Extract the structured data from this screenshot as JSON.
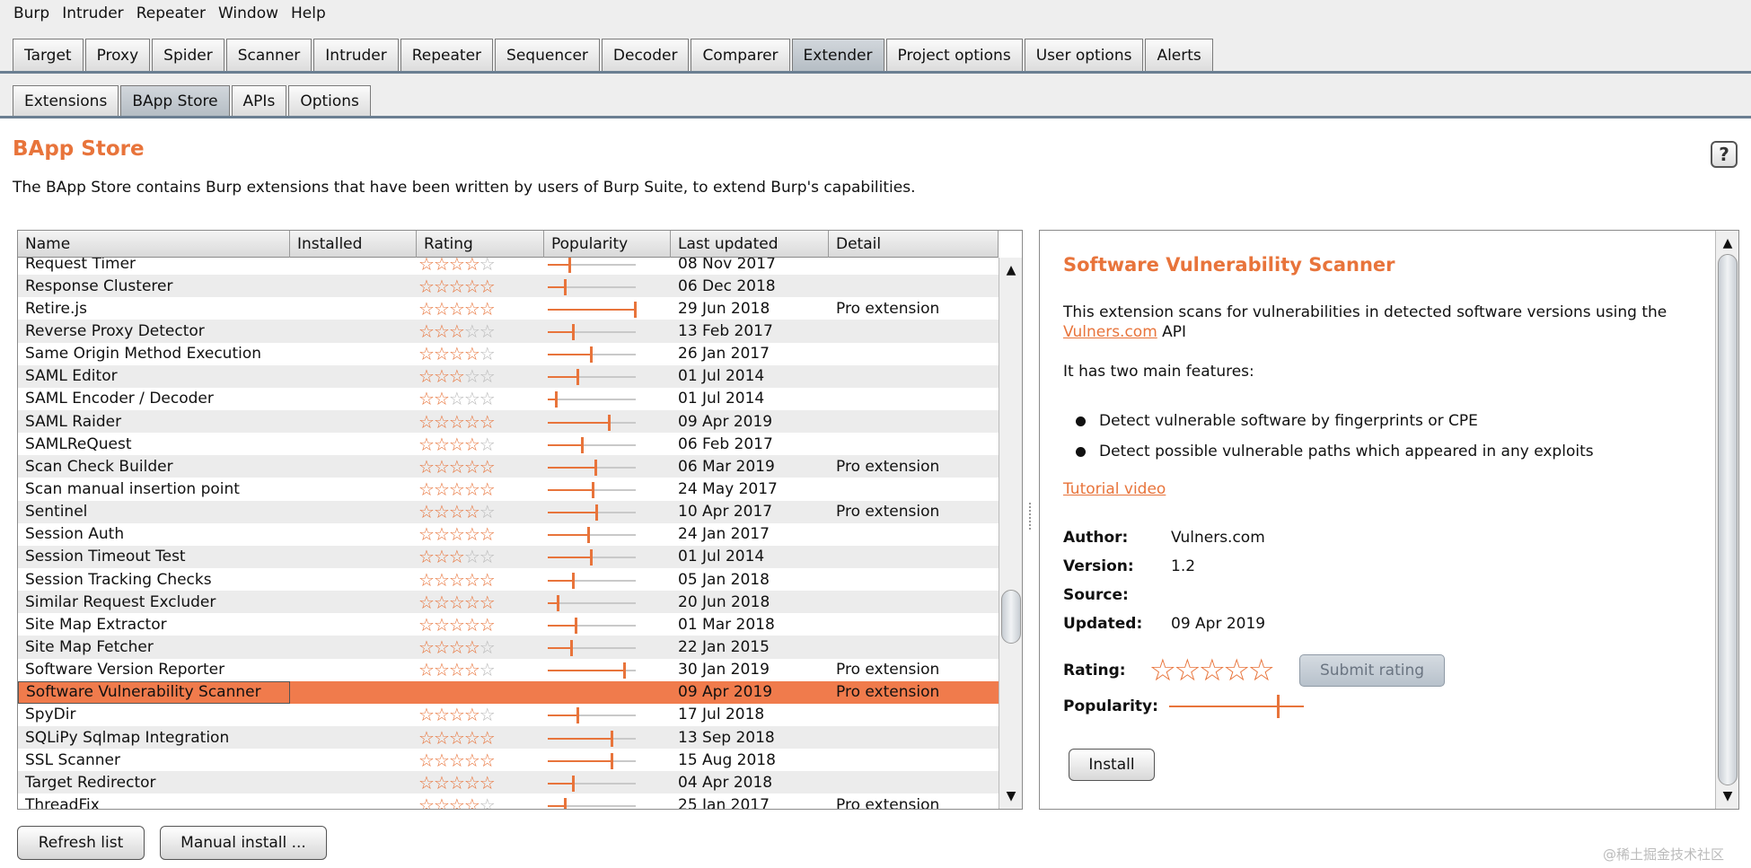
{
  "menu": [
    "Burp",
    "Intruder",
    "Repeater",
    "Window",
    "Help"
  ],
  "main_tabs": [
    "Target",
    "Proxy",
    "Spider",
    "Scanner",
    "Intruder",
    "Repeater",
    "Sequencer",
    "Decoder",
    "Comparer",
    "Extender",
    "Project options",
    "User options",
    "Alerts"
  ],
  "main_tab_active": "Extender",
  "sub_tabs": [
    "Extensions",
    "BApp Store",
    "APIs",
    "Options"
  ],
  "sub_tab_active": "BApp Store",
  "page": {
    "title": "BApp Store",
    "help_label": "?",
    "description": "The BApp Store contains Burp extensions that have been written by users of Burp Suite, to extend Burp's capabilities."
  },
  "table": {
    "columns": [
      "Name",
      "Installed",
      "Rating",
      "Popularity",
      "Last updated",
      "Detail"
    ],
    "rows": [
      {
        "name": "Request Timer",
        "rating": 4,
        "popularity": 0.25,
        "updated": "08 Nov 2017",
        "detail": ""
      },
      {
        "name": "Response Clusterer",
        "rating": 5,
        "popularity": 0.2,
        "updated": "06 Dec 2018",
        "detail": ""
      },
      {
        "name": "Retire.js",
        "rating": 5,
        "popularity": 1.0,
        "updated": "29 Jun 2018",
        "detail": "Pro extension"
      },
      {
        "name": "Reverse Proxy Detector",
        "rating": 3,
        "popularity": 0.3,
        "updated": "13 Feb 2017",
        "detail": ""
      },
      {
        "name": "Same Origin Method Execution",
        "rating": 4,
        "popularity": 0.5,
        "updated": "26 Jan 2017",
        "detail": ""
      },
      {
        "name": "SAML Editor",
        "rating": 3,
        "popularity": 0.35,
        "updated": "01 Jul 2014",
        "detail": ""
      },
      {
        "name": "SAML Encoder / Decoder",
        "rating": 2,
        "popularity": 0.1,
        "updated": "01 Jul 2014",
        "detail": ""
      },
      {
        "name": "SAML Raider",
        "rating": 5,
        "popularity": 0.7,
        "updated": "09 Apr 2019",
        "detail": ""
      },
      {
        "name": "SAMLReQuest",
        "rating": 4,
        "popularity": 0.4,
        "updated": "06 Feb 2017",
        "detail": ""
      },
      {
        "name": "Scan Check Builder",
        "rating": 5,
        "popularity": 0.55,
        "updated": "06 Mar 2019",
        "detail": "Pro extension"
      },
      {
        "name": "Scan manual insertion point",
        "rating": 5,
        "popularity": 0.52,
        "updated": "24 May 2017",
        "detail": ""
      },
      {
        "name": "Sentinel",
        "rating": 4,
        "popularity": 0.56,
        "updated": "10 Apr 2017",
        "detail": "Pro extension"
      },
      {
        "name": "Session Auth",
        "rating": 5,
        "popularity": 0.47,
        "updated": "24 Jan 2017",
        "detail": ""
      },
      {
        "name": "Session Timeout Test",
        "rating": 3,
        "popularity": 0.5,
        "updated": "01 Jul 2014",
        "detail": ""
      },
      {
        "name": "Session Tracking Checks",
        "rating": 5,
        "popularity": 0.3,
        "updated": "05 Jan 2018",
        "detail": ""
      },
      {
        "name": "Similar Request Excluder",
        "rating": 5,
        "popularity": 0.12,
        "updated": "20 Jun 2018",
        "detail": ""
      },
      {
        "name": "Site Map Extractor",
        "rating": 5,
        "popularity": 0.33,
        "updated": "01 Mar 2018",
        "detail": ""
      },
      {
        "name": "Site Map Fetcher",
        "rating": 4,
        "popularity": 0.28,
        "updated": "22 Jan 2015",
        "detail": ""
      },
      {
        "name": "Software Version Reporter",
        "rating": 4,
        "popularity": 0.88,
        "updated": "30 Jan 2019",
        "detail": "Pro extension"
      },
      {
        "name": "Software Vulnerability Scanner",
        "rating": 5,
        "popularity": 0.9,
        "updated": "09 Apr 2019",
        "detail": "Pro extension",
        "selected": true
      },
      {
        "name": "SpyDir",
        "rating": 4,
        "popularity": 0.35,
        "updated": "17 Jul 2018",
        "detail": ""
      },
      {
        "name": "SQLiPy Sqlmap Integration",
        "rating": 5,
        "popularity": 0.73,
        "updated": "13 Sep 2018",
        "detail": ""
      },
      {
        "name": "SSL Scanner",
        "rating": 5,
        "popularity": 0.73,
        "updated": "15 Aug 2018",
        "detail": ""
      },
      {
        "name": "Target Redirector",
        "rating": 5,
        "popularity": 0.3,
        "updated": "04 Apr 2018",
        "detail": ""
      },
      {
        "name": "ThreadFix",
        "rating": 4,
        "popularity": 0.2,
        "updated": "25 Jan 2017",
        "detail": "Pro extension"
      }
    ]
  },
  "detail": {
    "title": "Software Vulnerability Scanner",
    "desc_prefix": "This extension scans for vulnerabilities in detected software versions using the ",
    "desc_link": "Vulners.com",
    "desc_suffix": " API",
    "features_heading": "It has two main features:",
    "features": [
      "Detect vulnerable software by fingerprints or CPE",
      "Detect possible vulnerable paths which appeared in any exploits"
    ],
    "tutorial_link": "Tutorial video",
    "author_label": "Author:",
    "author": "Vulners.com",
    "version_label": "Version:",
    "version": "1.2",
    "source_label": "Source:",
    "source": "",
    "updated_label": "Updated:",
    "updated": "09 Apr 2019",
    "rating_label": "Rating:",
    "rating_stars": 5,
    "submit_rating": "Submit rating",
    "popularity_label": "Popularity:",
    "popularity": 0.8,
    "install": "Install"
  },
  "buttons": {
    "refresh": "Refresh list",
    "manual_install": "Manual install ..."
  },
  "watermark": "@稀土掘金技术社区",
  "colors": {
    "accent": "#e8743b",
    "selected_row": "#f07b4c"
  }
}
